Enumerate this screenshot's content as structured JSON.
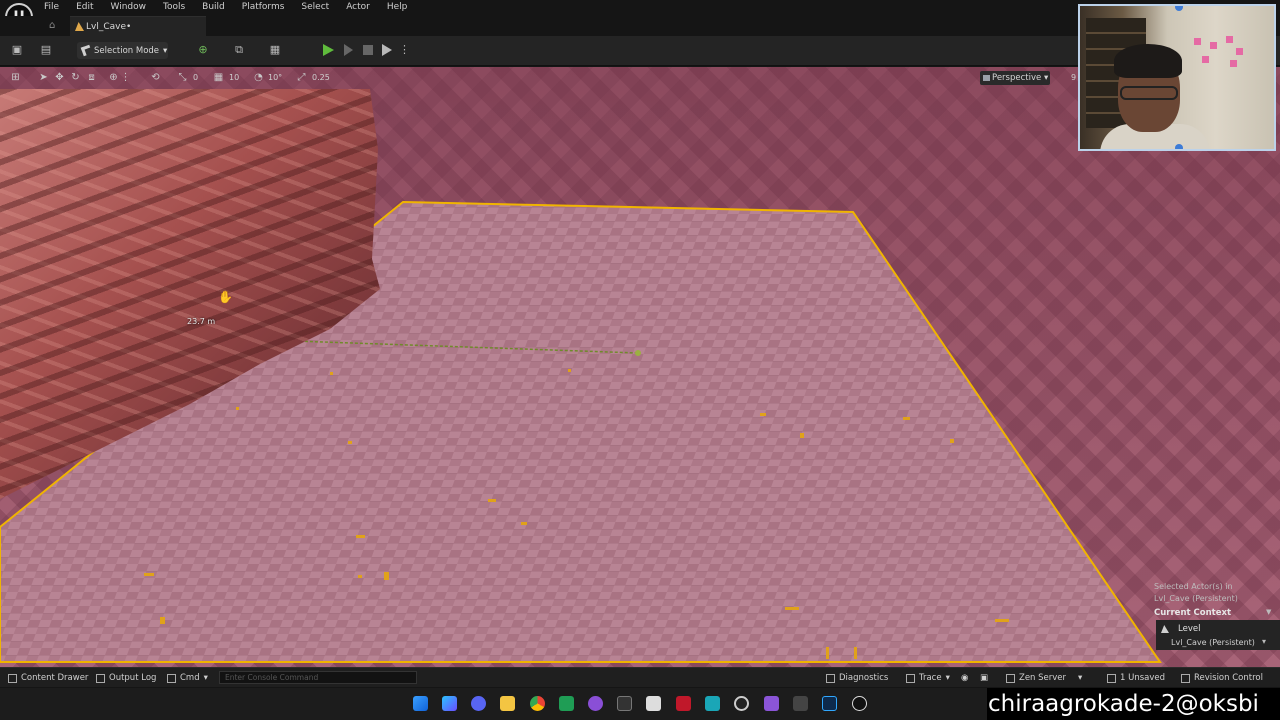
{
  "app": {
    "logo_text": "U"
  },
  "menu": [
    "File",
    "Edit",
    "Window",
    "Tools",
    "Build",
    "Platforms",
    "Select",
    "Actor",
    "Help"
  ],
  "tab": {
    "title": "Lvl_Cave•"
  },
  "toolbar": {
    "mode_label": "Selection Mode",
    "icons": [
      "save-icon",
      "content-browser-icon",
      "add-actor-icon",
      "blueprint-icon",
      "cinematics-icon",
      "play-icon",
      "step-icon",
      "stop-icon",
      "eject-icon",
      "more-icon"
    ]
  },
  "viewport": {
    "grid_snap": "10",
    "rotation_snap": "10°",
    "scale_snap": "0.25",
    "rotation_value": "0",
    "view_mode": "Perspective",
    "extra_value": "9",
    "measure_label": "23.7 m"
  },
  "details": {
    "selected_line1": "Selected Actor(s) in",
    "selected_line2": "Lvl_Cave (Persistent)",
    "context_title": "Current Context",
    "level_label": "Level",
    "level_value": "Lvl_Cave (Persistent)"
  },
  "bottombar": {
    "content_drawer": "Content Drawer",
    "output_log": "Output Log",
    "cmd": "Cmd",
    "console_placeholder": "Enter Console Command",
    "diagnostics": "Diagnostics",
    "trace": "Trace",
    "zen_server": "Zen Server",
    "unsaved": "1 Unsaved",
    "revision_control": "Revision Control"
  },
  "taskbar": {
    "icons": [
      "windows-start-icon",
      "copilot-icon",
      "discord-icon",
      "file-explorer-icon",
      "chrome-icon",
      "sheets-icon",
      "github-desktop-icon",
      "terminal-icon",
      "app-icon",
      "app-red-icon",
      "app-teal-icon",
      "obs-icon",
      "visual-studio-icon",
      "app-dark-icon",
      "photoshop-icon",
      "unreal-engine-icon"
    ],
    "watermark": "chiraagrokade-2@oksbi"
  },
  "colors": {
    "accent_play": "#5fbb3c",
    "selection_outline": "#f0b400",
    "viewport_floor": "#b07888",
    "webcam_border": "#bcd2ea"
  }
}
